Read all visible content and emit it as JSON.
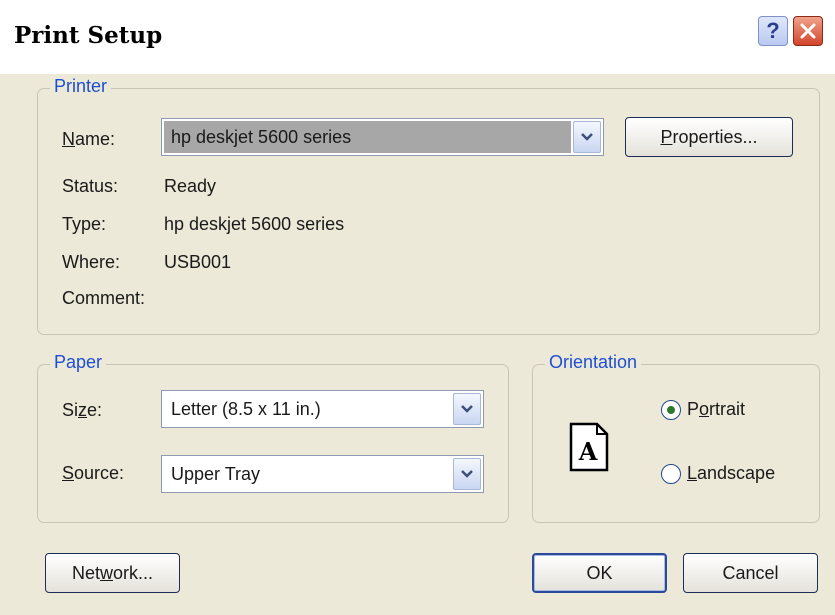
{
  "window": {
    "title": "Print Setup",
    "help_label": "?"
  },
  "printer": {
    "legend": "Printer",
    "name_label": "Name:",
    "name_value": "hp deskjet 5600 series",
    "properties_label": "Properties...",
    "status_label": "Status:",
    "status_value": "Ready",
    "type_label": "Type:",
    "type_value": "hp deskjet 5600 series",
    "where_label": "Where:",
    "where_value": "USB001",
    "comment_label": "Comment:",
    "comment_value": ""
  },
  "paper": {
    "legend": "Paper",
    "size_label": "Size:",
    "size_value": "Letter (8.5 x 11 in.)",
    "source_label": "Source:",
    "source_value": "Upper Tray"
  },
  "orientation": {
    "legend": "Orientation",
    "icon_letter": "A",
    "portrait_label": "Portrait",
    "landscape_label": "Landscape",
    "selected": "Portrait"
  },
  "buttons": {
    "network": "Network...",
    "ok": "OK",
    "cancel": "Cancel"
  },
  "icons": {
    "help": "help-icon",
    "close": "close-icon",
    "dropdown": "chevron-down-icon",
    "page": "page-icon"
  },
  "colors": {
    "legend": "#1f4fd1",
    "close": "#d2452b",
    "background": "#ece9d8"
  }
}
